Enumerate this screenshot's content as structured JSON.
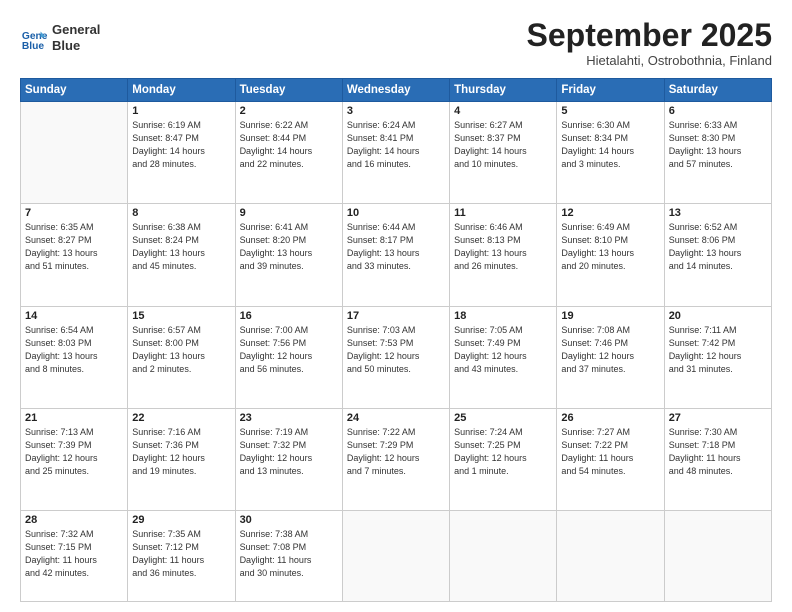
{
  "header": {
    "logo_line1": "General",
    "logo_line2": "Blue",
    "month": "September 2025",
    "location": "Hietalahti, Ostrobothnia, Finland"
  },
  "weekdays": [
    "Sunday",
    "Monday",
    "Tuesday",
    "Wednesday",
    "Thursday",
    "Friday",
    "Saturday"
  ],
  "rows": [
    [
      {
        "day": "",
        "lines": []
      },
      {
        "day": "1",
        "lines": [
          "Sunrise: 6:19 AM",
          "Sunset: 8:47 PM",
          "Daylight: 14 hours",
          "and 28 minutes."
        ]
      },
      {
        "day": "2",
        "lines": [
          "Sunrise: 6:22 AM",
          "Sunset: 8:44 PM",
          "Daylight: 14 hours",
          "and 22 minutes."
        ]
      },
      {
        "day": "3",
        "lines": [
          "Sunrise: 6:24 AM",
          "Sunset: 8:41 PM",
          "Daylight: 14 hours",
          "and 16 minutes."
        ]
      },
      {
        "day": "4",
        "lines": [
          "Sunrise: 6:27 AM",
          "Sunset: 8:37 PM",
          "Daylight: 14 hours",
          "and 10 minutes."
        ]
      },
      {
        "day": "5",
        "lines": [
          "Sunrise: 6:30 AM",
          "Sunset: 8:34 PM",
          "Daylight: 14 hours",
          "and 3 minutes."
        ]
      },
      {
        "day": "6",
        "lines": [
          "Sunrise: 6:33 AM",
          "Sunset: 8:30 PM",
          "Daylight: 13 hours",
          "and 57 minutes."
        ]
      }
    ],
    [
      {
        "day": "7",
        "lines": [
          "Sunrise: 6:35 AM",
          "Sunset: 8:27 PM",
          "Daylight: 13 hours",
          "and 51 minutes."
        ]
      },
      {
        "day": "8",
        "lines": [
          "Sunrise: 6:38 AM",
          "Sunset: 8:24 PM",
          "Daylight: 13 hours",
          "and 45 minutes."
        ]
      },
      {
        "day": "9",
        "lines": [
          "Sunrise: 6:41 AM",
          "Sunset: 8:20 PM",
          "Daylight: 13 hours",
          "and 39 minutes."
        ]
      },
      {
        "day": "10",
        "lines": [
          "Sunrise: 6:44 AM",
          "Sunset: 8:17 PM",
          "Daylight: 13 hours",
          "and 33 minutes."
        ]
      },
      {
        "day": "11",
        "lines": [
          "Sunrise: 6:46 AM",
          "Sunset: 8:13 PM",
          "Daylight: 13 hours",
          "and 26 minutes."
        ]
      },
      {
        "day": "12",
        "lines": [
          "Sunrise: 6:49 AM",
          "Sunset: 8:10 PM",
          "Daylight: 13 hours",
          "and 20 minutes."
        ]
      },
      {
        "day": "13",
        "lines": [
          "Sunrise: 6:52 AM",
          "Sunset: 8:06 PM",
          "Daylight: 13 hours",
          "and 14 minutes."
        ]
      }
    ],
    [
      {
        "day": "14",
        "lines": [
          "Sunrise: 6:54 AM",
          "Sunset: 8:03 PM",
          "Daylight: 13 hours",
          "and 8 minutes."
        ]
      },
      {
        "day": "15",
        "lines": [
          "Sunrise: 6:57 AM",
          "Sunset: 8:00 PM",
          "Daylight: 13 hours",
          "and 2 minutes."
        ]
      },
      {
        "day": "16",
        "lines": [
          "Sunrise: 7:00 AM",
          "Sunset: 7:56 PM",
          "Daylight: 12 hours",
          "and 56 minutes."
        ]
      },
      {
        "day": "17",
        "lines": [
          "Sunrise: 7:03 AM",
          "Sunset: 7:53 PM",
          "Daylight: 12 hours",
          "and 50 minutes."
        ]
      },
      {
        "day": "18",
        "lines": [
          "Sunrise: 7:05 AM",
          "Sunset: 7:49 PM",
          "Daylight: 12 hours",
          "and 43 minutes."
        ]
      },
      {
        "day": "19",
        "lines": [
          "Sunrise: 7:08 AM",
          "Sunset: 7:46 PM",
          "Daylight: 12 hours",
          "and 37 minutes."
        ]
      },
      {
        "day": "20",
        "lines": [
          "Sunrise: 7:11 AM",
          "Sunset: 7:42 PM",
          "Daylight: 12 hours",
          "and 31 minutes."
        ]
      }
    ],
    [
      {
        "day": "21",
        "lines": [
          "Sunrise: 7:13 AM",
          "Sunset: 7:39 PM",
          "Daylight: 12 hours",
          "and 25 minutes."
        ]
      },
      {
        "day": "22",
        "lines": [
          "Sunrise: 7:16 AM",
          "Sunset: 7:36 PM",
          "Daylight: 12 hours",
          "and 19 minutes."
        ]
      },
      {
        "day": "23",
        "lines": [
          "Sunrise: 7:19 AM",
          "Sunset: 7:32 PM",
          "Daylight: 12 hours",
          "and 13 minutes."
        ]
      },
      {
        "day": "24",
        "lines": [
          "Sunrise: 7:22 AM",
          "Sunset: 7:29 PM",
          "Daylight: 12 hours",
          "and 7 minutes."
        ]
      },
      {
        "day": "25",
        "lines": [
          "Sunrise: 7:24 AM",
          "Sunset: 7:25 PM",
          "Daylight: 12 hours",
          "and 1 minute."
        ]
      },
      {
        "day": "26",
        "lines": [
          "Sunrise: 7:27 AM",
          "Sunset: 7:22 PM",
          "Daylight: 11 hours",
          "and 54 minutes."
        ]
      },
      {
        "day": "27",
        "lines": [
          "Sunrise: 7:30 AM",
          "Sunset: 7:18 PM",
          "Daylight: 11 hours",
          "and 48 minutes."
        ]
      }
    ],
    [
      {
        "day": "28",
        "lines": [
          "Sunrise: 7:32 AM",
          "Sunset: 7:15 PM",
          "Daylight: 11 hours",
          "and 42 minutes."
        ]
      },
      {
        "day": "29",
        "lines": [
          "Sunrise: 7:35 AM",
          "Sunset: 7:12 PM",
          "Daylight: 11 hours",
          "and 36 minutes."
        ]
      },
      {
        "day": "30",
        "lines": [
          "Sunrise: 7:38 AM",
          "Sunset: 7:08 PM",
          "Daylight: 11 hours",
          "and 30 minutes."
        ]
      },
      {
        "day": "",
        "lines": []
      },
      {
        "day": "",
        "lines": []
      },
      {
        "day": "",
        "lines": []
      },
      {
        "day": "",
        "lines": []
      }
    ]
  ]
}
